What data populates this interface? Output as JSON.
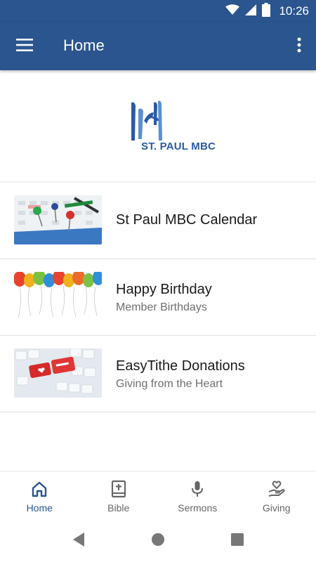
{
  "status_bar": {
    "time": "10:26",
    "icons": [
      "wifi-icon",
      "signal-icon",
      "battery-icon"
    ]
  },
  "app_bar": {
    "title": "Home",
    "menu_icon": "hamburger-menu-icon",
    "overflow_icon": "more-vert-icon"
  },
  "banner": {
    "logo_text": "ST. PAUL MBC"
  },
  "list": {
    "items": [
      {
        "title": "St Paul MBC Calendar",
        "subtitle": "",
        "thumb": "calendar-thumbnail"
      },
      {
        "title": "Happy Birthday",
        "subtitle": "Member Birthdays",
        "thumb": "balloons-thumbnail"
      },
      {
        "title": "EasyTithe Donations",
        "subtitle": "Giving from the Heart",
        "thumb": "donate-keyboard-thumbnail"
      }
    ]
  },
  "bottom_nav": {
    "items": [
      {
        "label": "Home",
        "icon": "home-icon",
        "active": true
      },
      {
        "label": "Bible",
        "icon": "bible-icon",
        "active": false
      },
      {
        "label": "Sermons",
        "icon": "microphone-icon",
        "active": false
      },
      {
        "label": "Giving",
        "icon": "giving-hand-heart-icon",
        "active": false
      }
    ]
  },
  "colors": {
    "primary": "#2a558f",
    "accent_blue": "#2a5aa8",
    "text_primary": "#1a1a1a",
    "text_secondary": "#6f6f6f",
    "nav_inactive": "#666666"
  }
}
